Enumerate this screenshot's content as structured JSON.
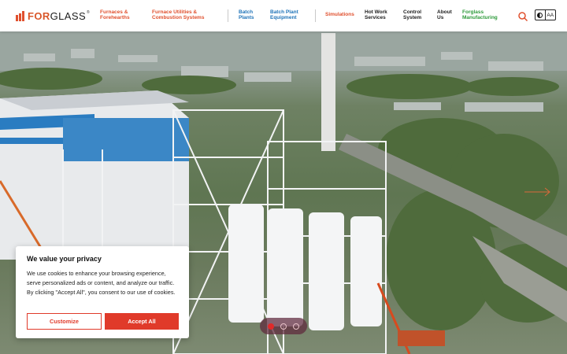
{
  "brand": {
    "logo_text_a": "FOR",
    "logo_text_b": "GLASS",
    "reg": "®",
    "accent": "#e0502e"
  },
  "nav": {
    "items": [
      {
        "line1": "Furnaces &",
        "line2": "Forehearths"
      },
      {
        "line1": "Furnace Utilities &",
        "line2": "Combustion Systems"
      },
      {
        "line1": "Batch",
        "line2": "Plants"
      },
      {
        "line1": "Batch Plant",
        "line2": "Equipment"
      },
      {
        "line1": "Simulations",
        "line2": ""
      },
      {
        "line1": "Hot Work",
        "line2": "Services"
      },
      {
        "line1": "Control",
        "line2": "System"
      },
      {
        "line1": "About",
        "line2": "Us"
      },
      {
        "line1": "Forglass",
        "line2": "Manufacturing"
      }
    ],
    "colors": {
      "red": "#e0502e",
      "blue": "#1f73b8",
      "dark": "#1c1c1c",
      "green": "#2d9a3a"
    }
  },
  "tools": {
    "search_icon": "search-icon",
    "contrast_icon": "contrast-icon",
    "text_size_label": "AA"
  },
  "cookie": {
    "title": "We value your privacy",
    "text": "We use cookies to enhance your browsing experience, serve personalized ads or content, and analyze our traffic. By clicking \"Accept All\", you consent to our use of cookies.",
    "customize_label": "Customize",
    "accept_label": "Accept All"
  },
  "slider": {
    "count": 3,
    "active": 1
  }
}
